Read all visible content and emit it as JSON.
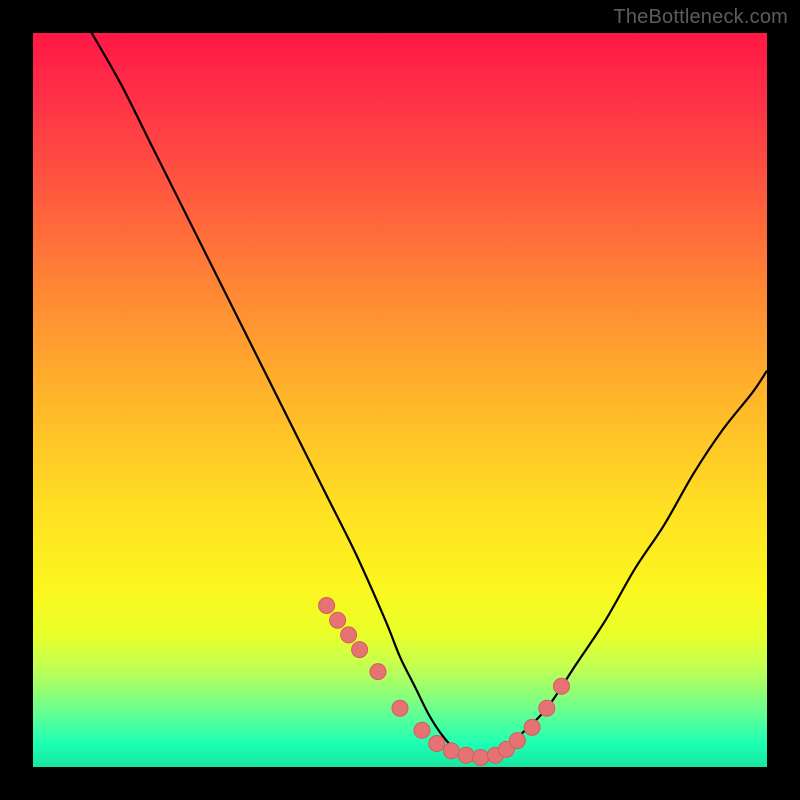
{
  "watermark": "TheBottleneck.com",
  "colors": {
    "frame": "#000000",
    "curve_stroke": "#000000",
    "marker_fill": "#e57373",
    "marker_stroke": "#d95b5b"
  },
  "chart_data": {
    "type": "line",
    "title": "",
    "xlabel": "",
    "ylabel": "",
    "xlim": [
      0,
      100
    ],
    "ylim": [
      0,
      100
    ],
    "grid": false,
    "series": [
      {
        "name": "bottleneck-curve",
        "x": [
          8,
          12,
          16,
          20,
          24,
          28,
          32,
          36,
          40,
          44,
          48,
          50,
          52,
          54,
          56,
          58,
          60,
          62,
          64,
          66,
          70,
          74,
          78,
          82,
          86,
          90,
          94,
          98,
          100
        ],
        "y": [
          100,
          93,
          85,
          77,
          69,
          61,
          53,
          45,
          37,
          29,
          20,
          15,
          11,
          7,
          4,
          2,
          1,
          1,
          2,
          4,
          8,
          14,
          20,
          27,
          33,
          40,
          46,
          51,
          54
        ]
      }
    ],
    "markers": {
      "name": "highlight-points",
      "x": [
        40,
        41.5,
        43,
        44.5,
        47,
        50,
        53,
        55,
        57,
        59,
        61,
        63,
        64.5,
        66,
        68,
        70,
        72
      ],
      "y": [
        22,
        20,
        18,
        16,
        13,
        8,
        5,
        3.2,
        2.2,
        1.6,
        1.3,
        1.6,
        2.4,
        3.6,
        5.4,
        8,
        11
      ]
    }
  }
}
